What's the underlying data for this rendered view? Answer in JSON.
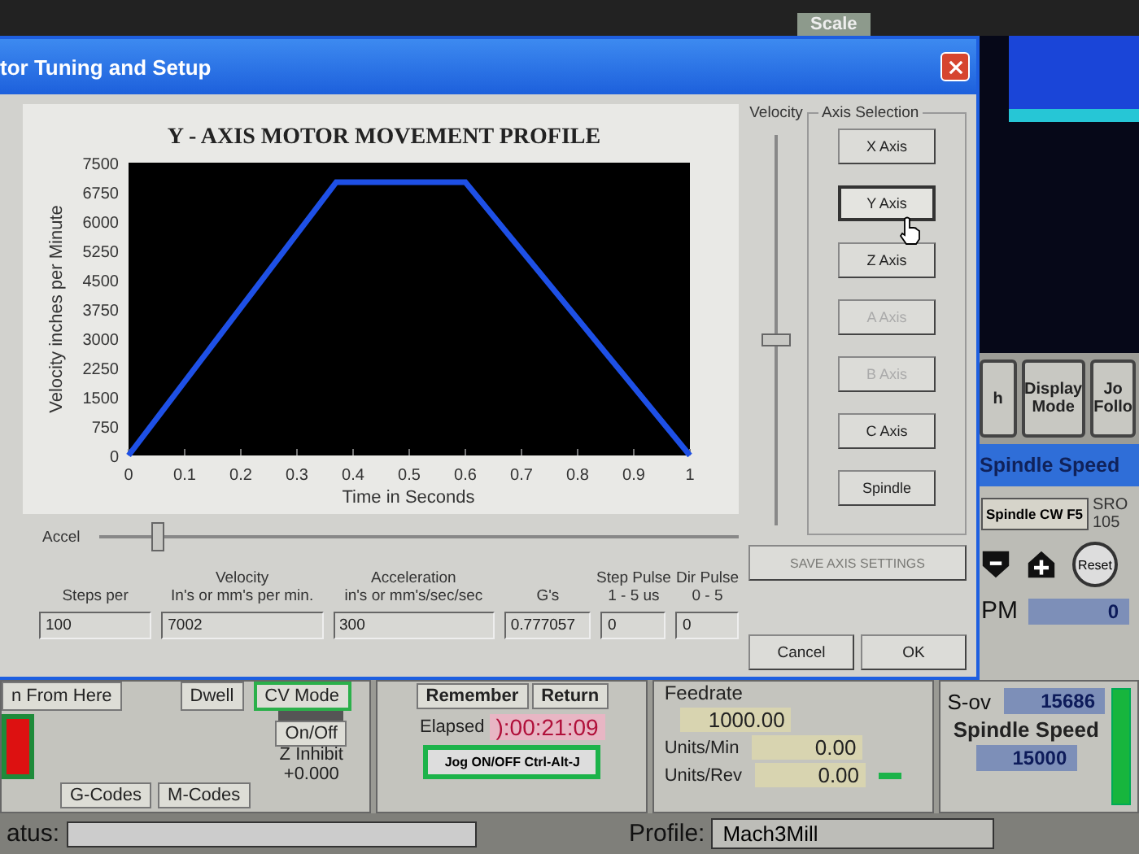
{
  "background": {
    "scale_label": "Scale",
    "right_panel": {
      "buttons": [
        {
          "label": "h"
        },
        {
          "label": "Display Mode"
        },
        {
          "label": "Jo Follo"
        }
      ],
      "header": "Spindle Speed",
      "spindle_button": "Spindle CW F5",
      "sro_label": "SRO",
      "sro_value": "105",
      "reset_button": "Reset",
      "rpm_label": "PM",
      "rpm_value": "0"
    },
    "program_panel": {
      "run_from_here": "n From Here",
      "dwell": "Dwell",
      "cv_mode": "CV Mode",
      "on_off": "On/Off",
      "z_inhibit": "Z Inhibit",
      "z_value": "+0.000",
      "gcodes": "G-Codes",
      "mcodes": "M-Codes"
    },
    "time_panel": {
      "remember": "Remember",
      "return": "Return",
      "elapsed_label": "Elapsed",
      "elapsed_value": "):00:21:09",
      "jog_button": "Jog ON/OFF Ctrl-Alt-J"
    },
    "feed_panel": {
      "title": "Feedrate",
      "feedrate": "1000.00",
      "units_min_label": "Units/Min",
      "units_min": "0.00",
      "units_rev_label": "Units/Rev",
      "units_rev": "0.00"
    },
    "spindle_panel": {
      "sov_label": "S-ov",
      "sov_value": "15686",
      "speed_label": "Spindle Speed",
      "speed_value": "15000"
    },
    "status_bar": {
      "status_label": "atus:",
      "profile_label": "Profile:",
      "profile_value": "Mach3Mill"
    }
  },
  "dialog": {
    "title": "tor Tuning and Setup",
    "chart": {
      "chart_data": {
        "type": "line",
        "title": "Y - AXIS MOTOR MOVEMENT PROFILE",
        "xlabel": "Time in Seconds",
        "ylabel": "Velocity inches per Minute",
        "xlim": [
          0,
          1
        ],
        "ylim": [
          0,
          7500
        ],
        "xticks": [
          0,
          0.1,
          0.2,
          0.3,
          0.4,
          0.5,
          0.6,
          0.7,
          0.8,
          0.9,
          1
        ],
        "yticks": [
          0,
          750,
          1500,
          2250,
          3000,
          3750,
          4500,
          5250,
          6000,
          6750,
          7500
        ],
        "x": [
          0,
          0.37,
          0.6,
          1
        ],
        "series": [
          {
            "color": "#1e50e6",
            "values": [
              0,
              7000,
              7000,
              0
            ]
          }
        ]
      }
    },
    "velocity_slider": {
      "label": "Velocity",
      "level": 0.46
    },
    "axis_selection": {
      "title": "Axis Selection",
      "buttons": [
        {
          "label": "X Axis",
          "selected": false,
          "disabled": false
        },
        {
          "label": "Y Axis",
          "selected": true,
          "disabled": false
        },
        {
          "label": "Z Axis",
          "selected": false,
          "disabled": false
        },
        {
          "label": "A Axis",
          "selected": false,
          "disabled": true
        },
        {
          "label": "B Axis",
          "selected": false,
          "disabled": true
        },
        {
          "label": "C Axis",
          "selected": false,
          "disabled": false
        },
        {
          "label": "Spindle",
          "selected": false,
          "disabled": false
        }
      ]
    },
    "accel_slider": {
      "label": "Accel",
      "level": 0.08
    },
    "fields": [
      {
        "label": "Steps per",
        "value": "100"
      },
      {
        "label": "Velocity",
        "sublabel": "In's or mm's per min.",
        "value": "7002"
      },
      {
        "label": "Acceleration",
        "sublabel": "in's or mm's/sec/sec",
        "value": "300"
      },
      {
        "label": "G's",
        "value": "0.777057"
      },
      {
        "label": "Step Pulse",
        "sublabel": "1 - 5 us",
        "value": "0"
      },
      {
        "label": "Dir Pulse",
        "sublabel": "0 - 5",
        "value": "0"
      }
    ],
    "save_button": {
      "label": "SAVE AXIS SETTINGS",
      "disabled": true
    },
    "buttons": [
      {
        "label": "Cancel",
        "disabled": false
      },
      {
        "label": "OK",
        "disabled": false
      }
    ]
  }
}
